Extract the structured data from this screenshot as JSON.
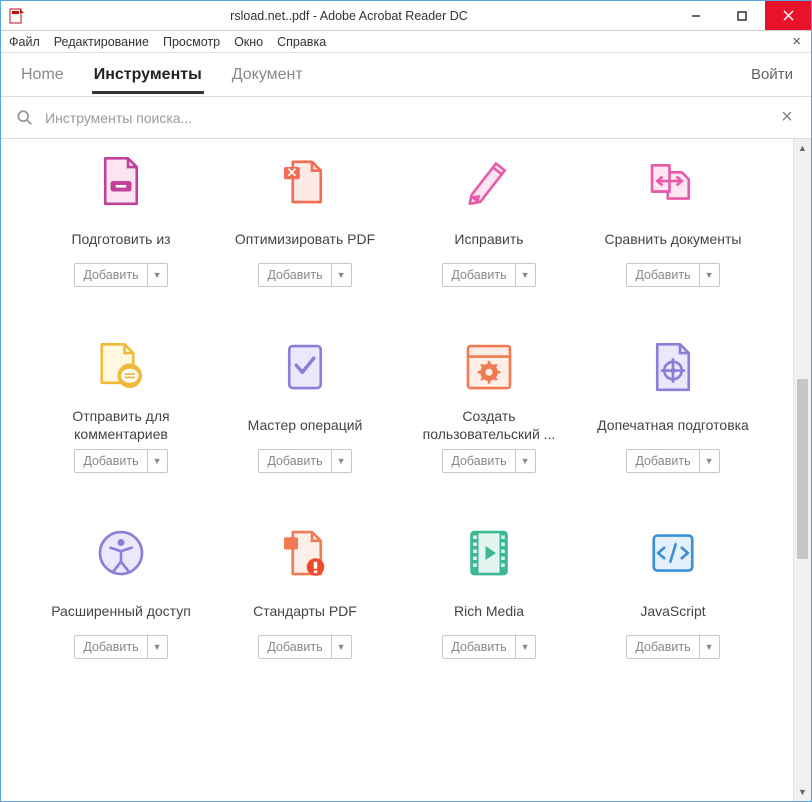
{
  "window": {
    "title": "rsload.net..pdf - Adobe Acrobat Reader DC"
  },
  "menu": {
    "items": [
      "Файл",
      "Редактирование",
      "Просмотр",
      "Окно",
      "Справка"
    ]
  },
  "tabs": {
    "home": "Home",
    "tools": "Инструменты",
    "document": "Документ",
    "login": "Войти"
  },
  "search": {
    "placeholder": "Инструменты поиска..."
  },
  "add_label": "Добавить",
  "tools": [
    {
      "id": "prepare",
      "label": "Подготовить из"
    },
    {
      "id": "optimize",
      "label": "Оптимизировать PDF"
    },
    {
      "id": "redact",
      "label": "Исправить"
    },
    {
      "id": "compare",
      "label": "Сравнить документы"
    },
    {
      "id": "sendcomment",
      "label": "Отправить для комментариев"
    },
    {
      "id": "action",
      "label": "Мастер операций"
    },
    {
      "id": "custom",
      "label": "Создать пользовательский ..."
    },
    {
      "id": "preflight",
      "label": "Допечатная подготовка"
    },
    {
      "id": "access",
      "label": "Расширенный доступ"
    },
    {
      "id": "standards",
      "label": "Стандарты PDF"
    },
    {
      "id": "richmedia",
      "label": "Rich Media"
    },
    {
      "id": "javascript",
      "label": "JavaScript"
    }
  ]
}
